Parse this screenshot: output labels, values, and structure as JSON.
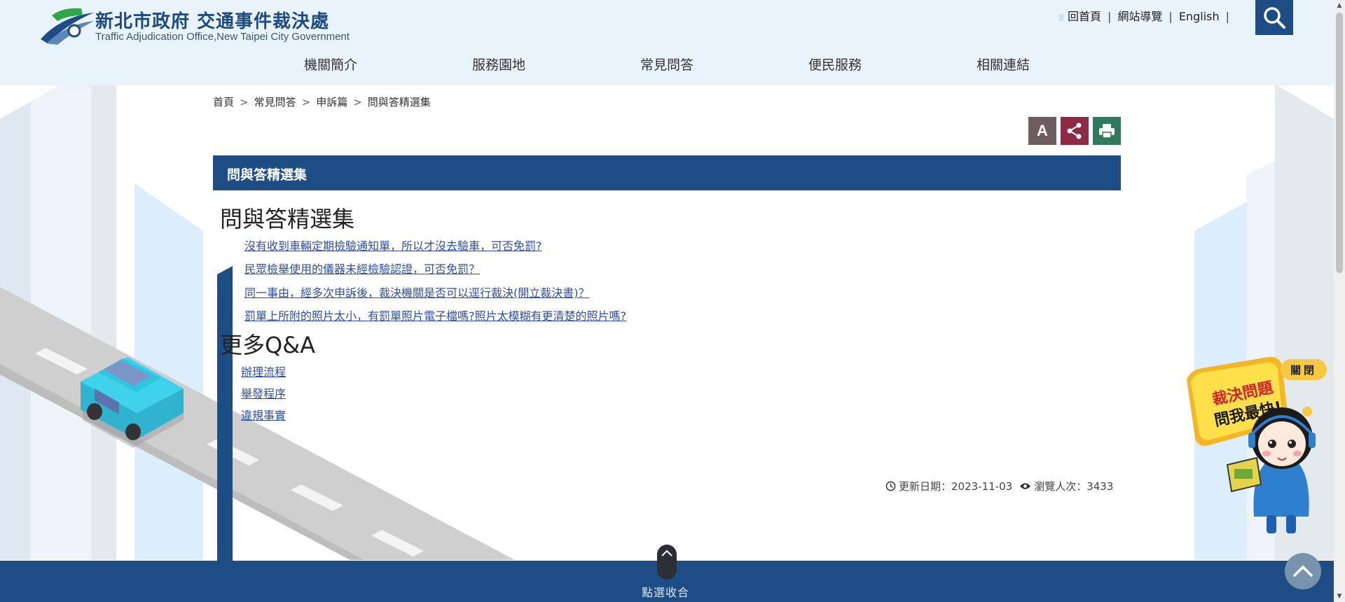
{
  "header": {
    "title_cn": "新北市政府 交通事件裁決處",
    "title_en": "Traffic Adjudication Office,New Taipei City Government",
    "top_links": [
      "回首頁",
      "網站導覽",
      "English"
    ],
    "separator": "|",
    "search_icon": "search-icon",
    "nav": [
      "機關簡介",
      "服務園地",
      "常見問答",
      "便民服務",
      "相關連結"
    ]
  },
  "breadcrumb": {
    "items": [
      "首頁",
      "常見問答",
      "申訴篇",
      "問與答精選集"
    ],
    "arrow": ">"
  },
  "tools": {
    "font_label": "A",
    "share_icon": "share-icon",
    "print_icon": "print-icon"
  },
  "page": {
    "bar_title": "問與答精選集",
    "heading": "問與答精選集",
    "questions": [
      "沒有收到車輛定期檢驗通知單，所以才沒去驗車，可否免罰?",
      "民眾檢舉使用的儀器未經檢驗認證，可否免罰？",
      "同一事由，經多次申訴後，裁決機關是否可以逕行裁決(開立裁決書)？",
      "罰單上所附的照片太小，有罰單照片電子檔嗎?照片太模糊有更清楚的照片嗎?"
    ],
    "more_heading": "更多Q&A",
    "more_links": [
      "辦理流程",
      "舉發程序",
      "違規事實"
    ],
    "updated_label": "更新日期：2023-11-03",
    "views_label": "瀏覽人次：3433"
  },
  "footer": {
    "toggle_label": "點選收合"
  },
  "mascot": {
    "close_label": "關閉",
    "badge_line1": "裁決問題",
    "badge_line2": "問我最快!"
  },
  "colors": {
    "primary": "#1d4d84",
    "header_bg": "#e8f3fb",
    "link": "#2c4fa8",
    "share": "#8e2a45",
    "print": "#2f7a5c",
    "font_tool": "#6e5c5e",
    "accent_yellow": "#f6c840"
  }
}
